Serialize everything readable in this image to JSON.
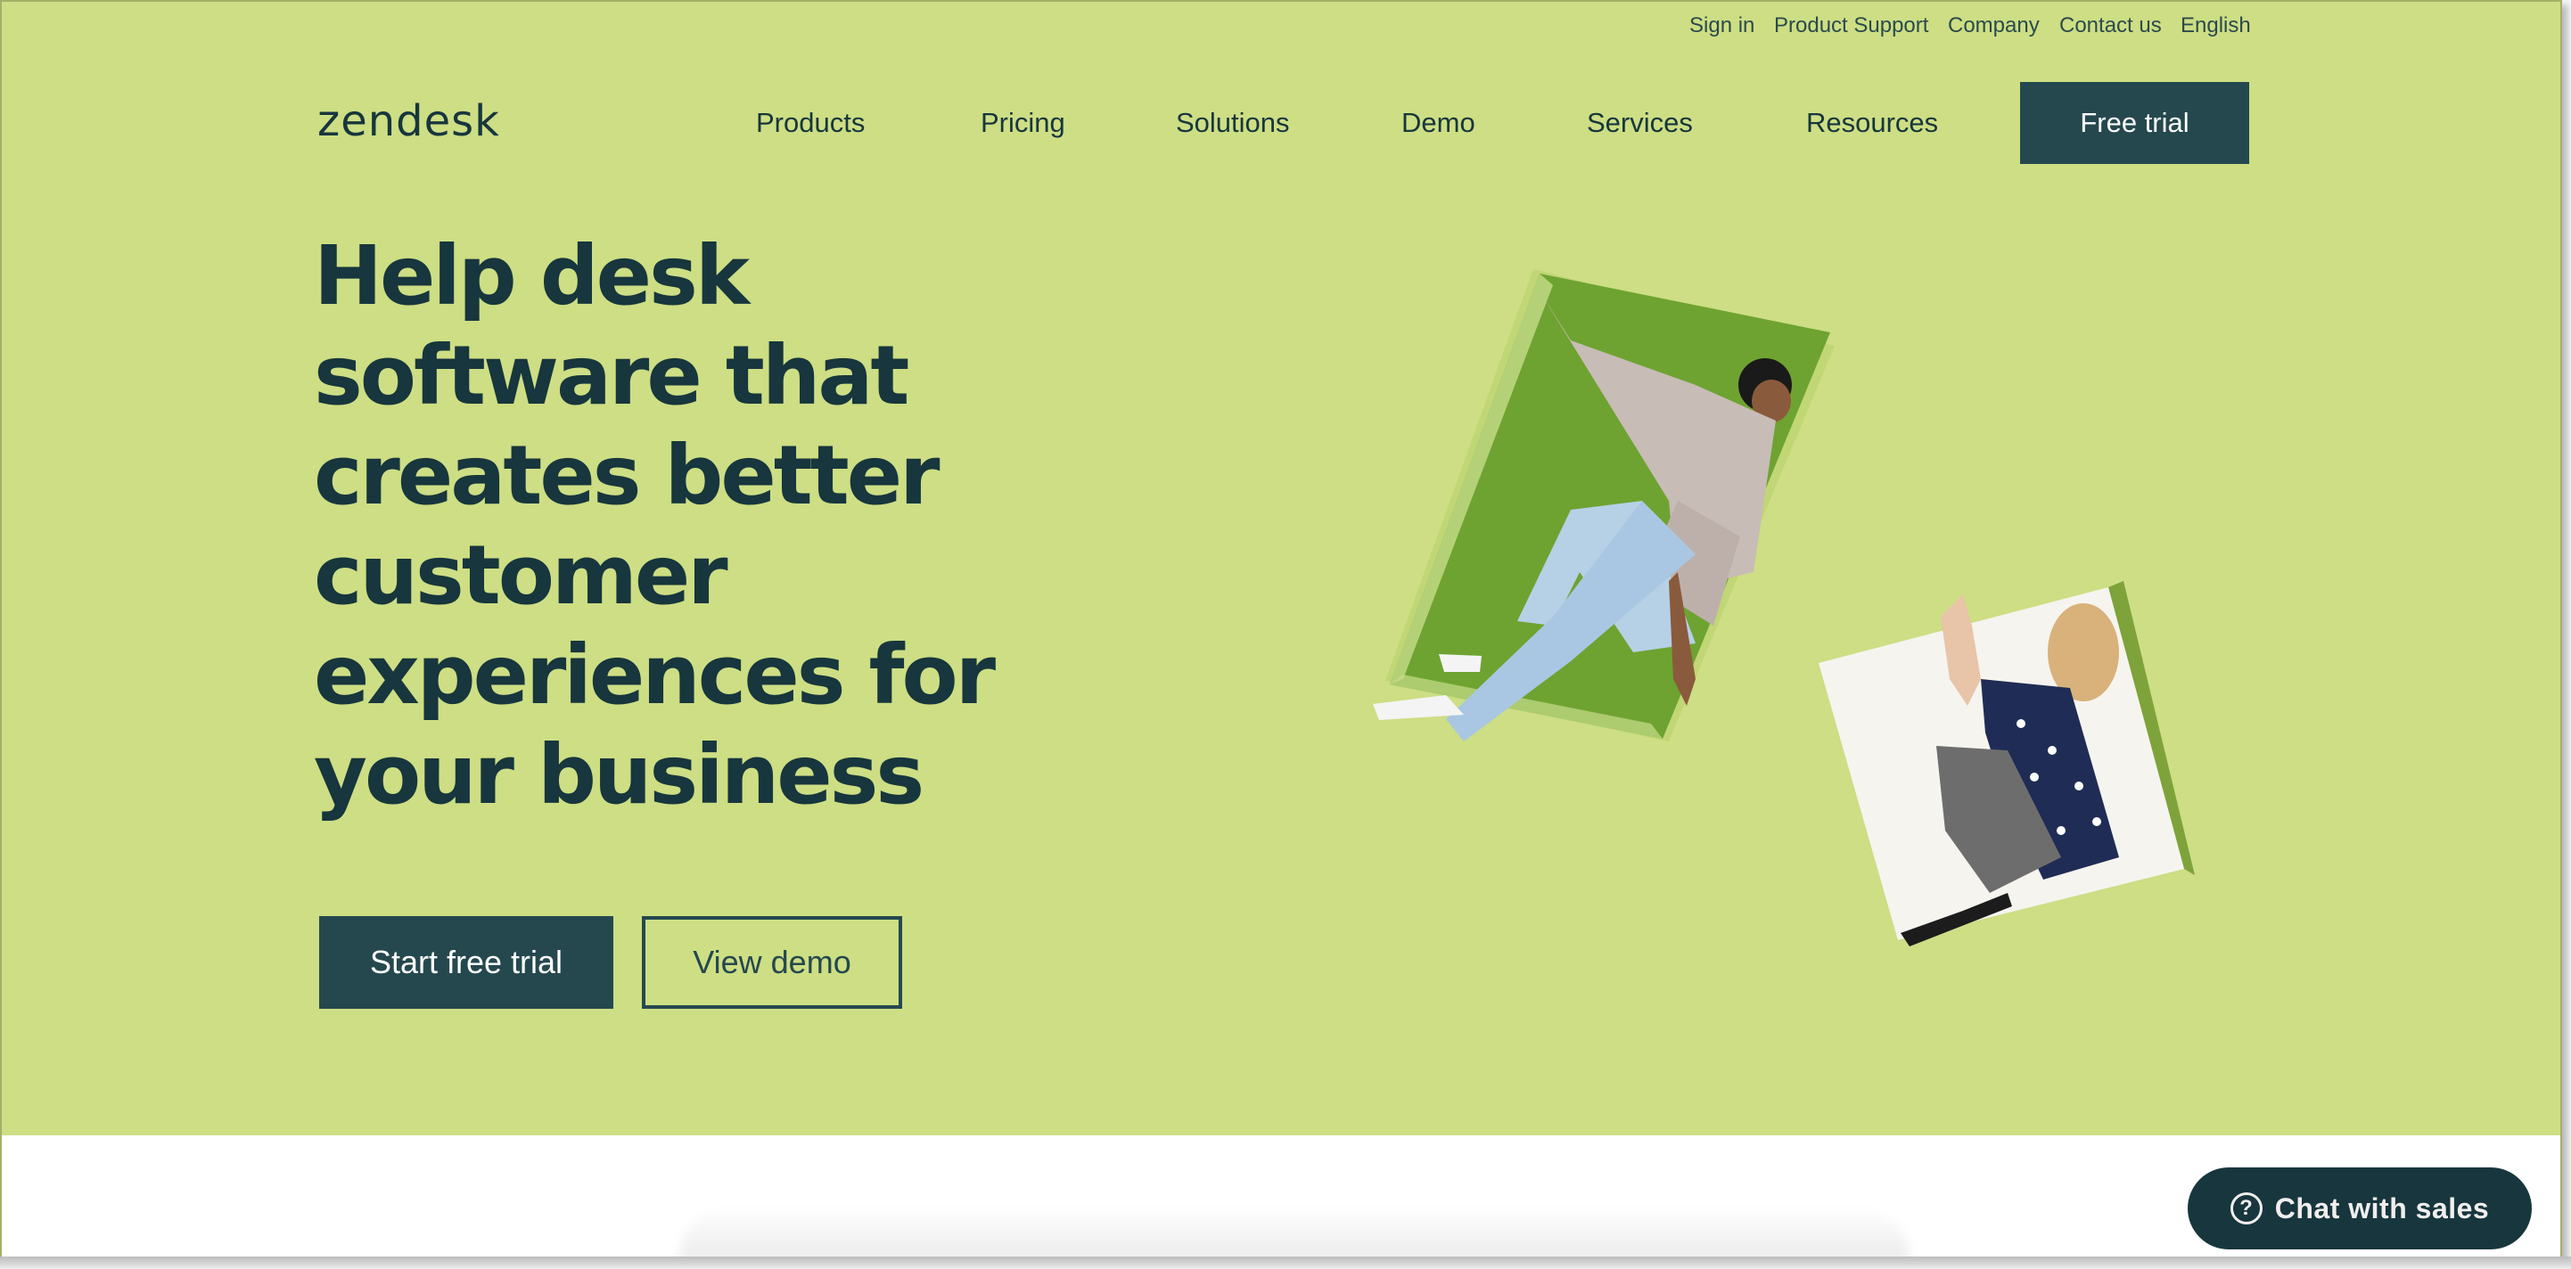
{
  "utility_nav": [
    "Sign in",
    "Product Support",
    "Company",
    "Contact us",
    "English"
  ],
  "brand": {
    "logo_text": "zendesk"
  },
  "main_nav": [
    "Products",
    "Pricing",
    "Solutions",
    "Demo",
    "Services",
    "Resources"
  ],
  "header_cta": "Free trial",
  "hero": {
    "headline_lines": [
      "Help desk",
      "software that",
      "creates better",
      "customer",
      "experiences for",
      "your business"
    ],
    "primary_cta": "Start free trial",
    "secondary_cta": "View demo",
    "illustration": {
      "panel_1": "person in green open box",
      "panel_2": "person in white open box"
    }
  },
  "chat_widget": {
    "label": "Chat with sales",
    "icon": "question-circle-icon"
  },
  "colors": {
    "hero_bg": "#cdde84",
    "dark_teal": "#25484e",
    "text_dark": "#17363d",
    "chat_bg": "#17363d"
  }
}
